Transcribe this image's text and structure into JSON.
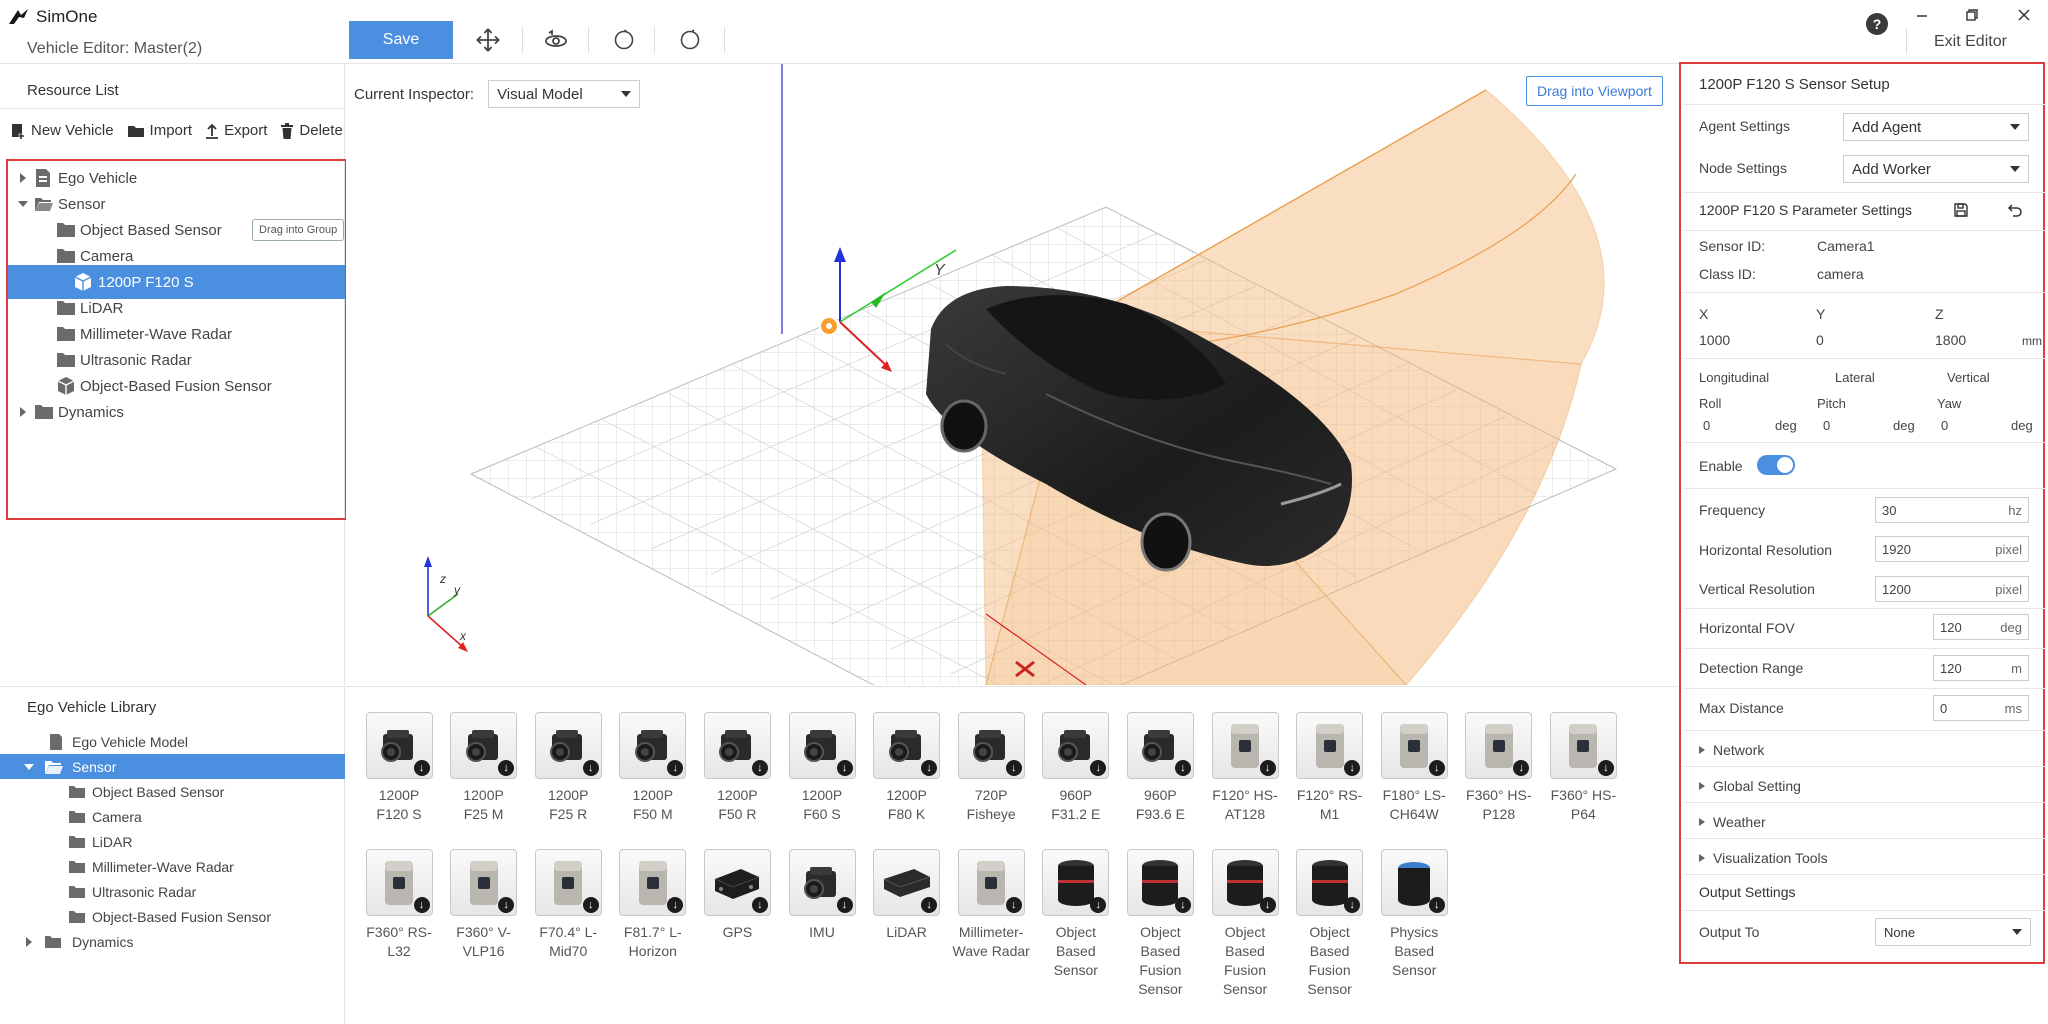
{
  "app": {
    "name": "SimOne",
    "subtitle": "Vehicle Editor: Master(2)"
  },
  "toolbar": {
    "save": "Save",
    "help": "?",
    "exit": "Exit Editor"
  },
  "resource": {
    "title": "Resource List",
    "actions": {
      "new": "New Vehicle",
      "import": "Import",
      "export": "Export",
      "delete": "Delete"
    },
    "tree": {
      "ego": "Ego Vehicle",
      "sensor": "Sensor",
      "object_based": "Object Based Sensor",
      "drag_group": "Drag into Group",
      "camera": "Camera",
      "selected": "1200P F120 S",
      "lidar": "LiDAR",
      "mmwave": "Millimeter-Wave Radar",
      "ultrasonic": "Ultrasonic Radar",
      "fusion": "Object-Based Fusion Sensor",
      "dynamics": "Dynamics"
    }
  },
  "viewport": {
    "inspector_label": "Current Inspector:",
    "inspector_value": "Visual Model",
    "drag_btn": "Drag into Viewport",
    "axis": {
      "z": "z",
      "y": "y",
      "x": "x",
      "big_y": "Y"
    }
  },
  "library_tree": {
    "title": "Ego Vehicle Library",
    "model": "Ego Vehicle Model",
    "sensor": "Sensor",
    "object_based": "Object Based Sensor",
    "camera": "Camera",
    "lidar": "LiDAR",
    "mmwave": "Millimeter-Wave Radar",
    "ultrasonic": "Ultrasonic Radar",
    "fusion": "Object-Based Fusion Sensor",
    "dynamics": "Dynamics"
  },
  "library": {
    "row1": [
      {
        "l1": "1200P",
        "l2": "F120 S",
        "kind": "cam"
      },
      {
        "l1": "1200P",
        "l2": "F25 M",
        "kind": "cam"
      },
      {
        "l1": "1200P",
        "l2": "F25 R",
        "kind": "cam"
      },
      {
        "l1": "1200P",
        "l2": "F50 M",
        "kind": "cam"
      },
      {
        "l1": "1200P",
        "l2": "F50 R",
        "kind": "cam"
      },
      {
        "l1": "1200P",
        "l2": "F60 S",
        "kind": "cam"
      },
      {
        "l1": "1200P",
        "l2": "F80 K",
        "kind": "cam"
      },
      {
        "l1": "720P",
        "l2": "Fisheye",
        "kind": "cam"
      },
      {
        "l1": "960P",
        "l2": "F31.2 E",
        "kind": "cam"
      },
      {
        "l1": "960P",
        "l2": "F93.6 E",
        "kind": "cam"
      },
      {
        "l1": "F120° HS-",
        "l2": "AT128",
        "kind": "lidar"
      },
      {
        "l1": "F120° RS-",
        "l2": "M1",
        "kind": "lidar"
      },
      {
        "l1": "F180° LS-",
        "l2": "CH64W",
        "kind": "lidar"
      },
      {
        "l1": "F360° HS-",
        "l2": "P128",
        "kind": "lidar"
      },
      {
        "l1": "F360° HS-",
        "l2": "P64",
        "kind": "lidar"
      }
    ],
    "row2": [
      {
        "l1": "F360° RS-",
        "l2": "L32",
        "l3": "",
        "l4": "",
        "kind": "lidar"
      },
      {
        "l1": "F360° V-",
        "l2": "VLP16",
        "l3": "",
        "l4": "",
        "kind": "lidar"
      },
      {
        "l1": "F70.4° L-",
        "l2": "Mid70",
        "l3": "",
        "l4": "",
        "kind": "lidar"
      },
      {
        "l1": "F81.7° L-",
        "l2": "Horizon",
        "l3": "",
        "l4": "",
        "kind": "lidar"
      },
      {
        "l1": "GPS",
        "l2": "",
        "l3": "",
        "l4": "",
        "kind": "gps"
      },
      {
        "l1": "IMU",
        "l2": "",
        "l3": "",
        "l4": "",
        "kind": "cam"
      },
      {
        "l1": "LiDAR",
        "l2": "",
        "l3": "",
        "l4": "",
        "kind": "box"
      },
      {
        "l1": "Millimeter-",
        "l2": "Wave Radar",
        "l3": "",
        "l4": "",
        "kind": "lidar"
      },
      {
        "l1": "Object",
        "l2": "Based",
        "l3": "Sensor",
        "l4": "",
        "kind": "cyl"
      },
      {
        "l1": "Object",
        "l2": "Based",
        "l3": "Fusion",
        "l4": "Sensor",
        "kind": "cyl"
      },
      {
        "l1": "Object",
        "l2": "Based",
        "l3": "Fusion",
        "l4": "Sensor",
        "kind": "cyl"
      },
      {
        "l1": "Object",
        "l2": "Based",
        "l3": "Fusion",
        "l4": "Sensor",
        "kind": "cyl"
      },
      {
        "l1": "Physics",
        "l2": "Based",
        "l3": "Sensor",
        "l4": "",
        "kind": "cylblue"
      }
    ]
  },
  "props": {
    "title": "1200P F120 S Sensor Setup",
    "agent_label": "Agent Settings",
    "agent_value": "Add Agent",
    "node_label": "Node Settings",
    "node_value": "Add Worker",
    "param_title": "1200P F120 S Parameter Settings",
    "sensor_id_label": "Sensor ID:",
    "sensor_id": "Camera1",
    "class_id_label": "Class ID:",
    "class_id": "camera",
    "x_label": "X",
    "y_label": "Y",
    "z_label": "Z",
    "x": "1000",
    "y": "0",
    "z": "1800",
    "pos_unit": "mm",
    "long": "Longitudinal",
    "lat": "Lateral",
    "vert": "Vertical",
    "roll": "Roll",
    "pitch": "Pitch",
    "yaw": "Yaw",
    "roll_v": "0",
    "pitch_v": "0",
    "yaw_v": "0",
    "deg": "deg",
    "enable": "Enable",
    "freq_label": "Frequency",
    "freq": "30",
    "freq_u": "hz",
    "hres_label": "Horizontal Resolution",
    "hres": "1920",
    "hres_u": "pixel",
    "vres_label": "Vertical Resolution",
    "vres": "1200",
    "vres_u": "pixel",
    "hfov_label": "Horizontal FOV",
    "hfov": "120",
    "hfov_u": "deg",
    "det_label": "Detection Range",
    "det": "120",
    "det_u": "m",
    "max_label": "Max Distance",
    "max": "0",
    "max_u": "ms",
    "network": "Network",
    "global": "Global Setting",
    "weather": "Weather",
    "vis": "Visualization Tools",
    "output_title": "Output Settings",
    "output_label": "Output To",
    "output_value": "None"
  },
  "colors": {
    "accent": "#4a8fe0",
    "highlight_border": "#e03c3c",
    "fov": "#f4b87a"
  }
}
